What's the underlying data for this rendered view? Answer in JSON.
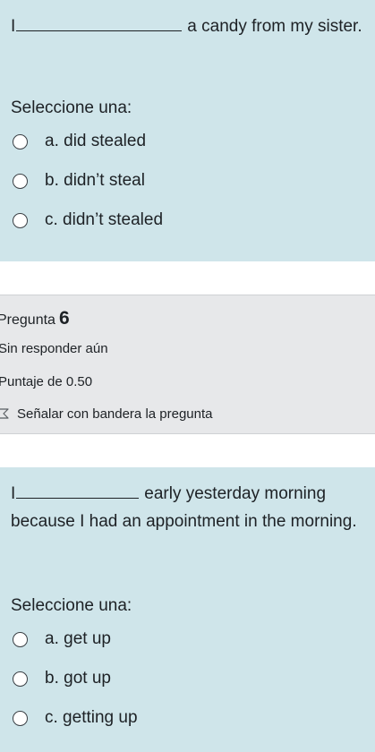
{
  "question5": {
    "text_before": "I",
    "text_after": "a candy from my sister.",
    "prompt": "Seleccione una:",
    "options": [
      "a. did stealed",
      "b. didn’t steal",
      "c. didn’t stealed"
    ]
  },
  "question6_info": {
    "label": "Pregunta",
    "number": "6",
    "state": "Sin responder aún",
    "grade": "Puntaje de 0.50",
    "flag_label": "Señalar con bandera la pregunta"
  },
  "question6": {
    "text_before": "I",
    "text_after": "early yesterday morning because I had an appointment in the morning.",
    "prompt": "Seleccione una:",
    "options": [
      "a. get up",
      "b. got up",
      "c. getting up"
    ]
  }
}
